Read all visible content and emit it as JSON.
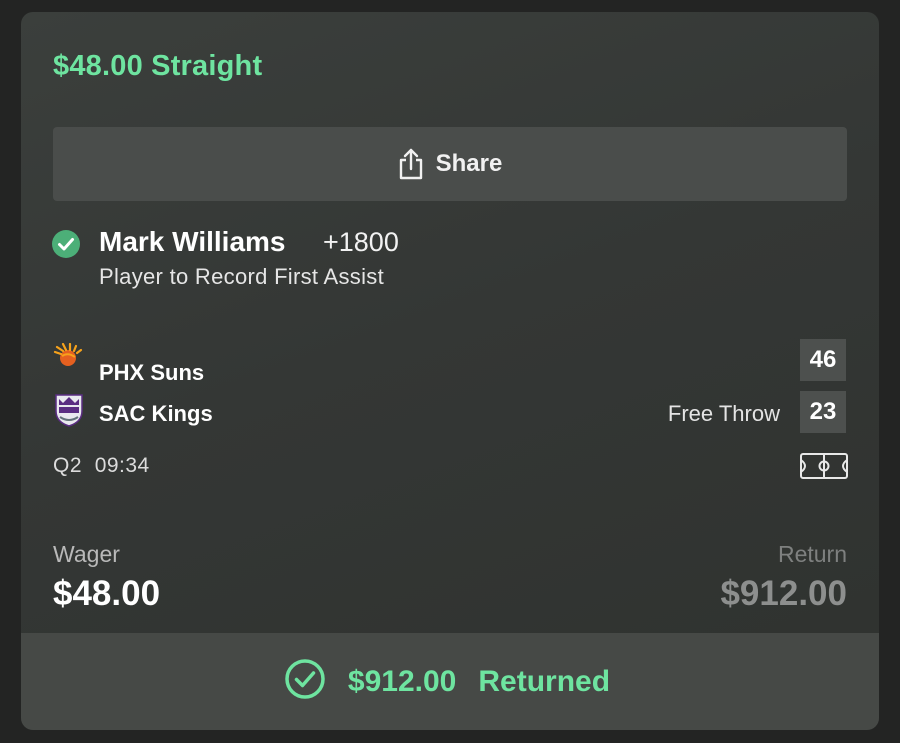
{
  "bet": {
    "title": "$48.00 Straight",
    "share_label": "Share"
  },
  "selection": {
    "player": "Mark Williams",
    "odds": "+1800",
    "market": "Player to Record First Assist"
  },
  "game": {
    "teams": [
      {
        "name": "PHX Suns",
        "score": "46",
        "logo_icon": "suns-logo-icon"
      },
      {
        "name": "SAC Kings",
        "score": "23",
        "logo_icon": "kings-logo-icon"
      }
    ],
    "event_status": "Free Throw",
    "period": "Q2",
    "clock": "09:34"
  },
  "totals": {
    "wager_label": "Wager",
    "wager_amount": "$48.00",
    "return_label": "Return",
    "return_amount": "$912.00"
  },
  "result": {
    "amount": "$912.00",
    "status": "Returned"
  },
  "colors": {
    "accent_green": "#6ee4a0",
    "check_green": "#4caf78",
    "card_bg": "#363937"
  }
}
